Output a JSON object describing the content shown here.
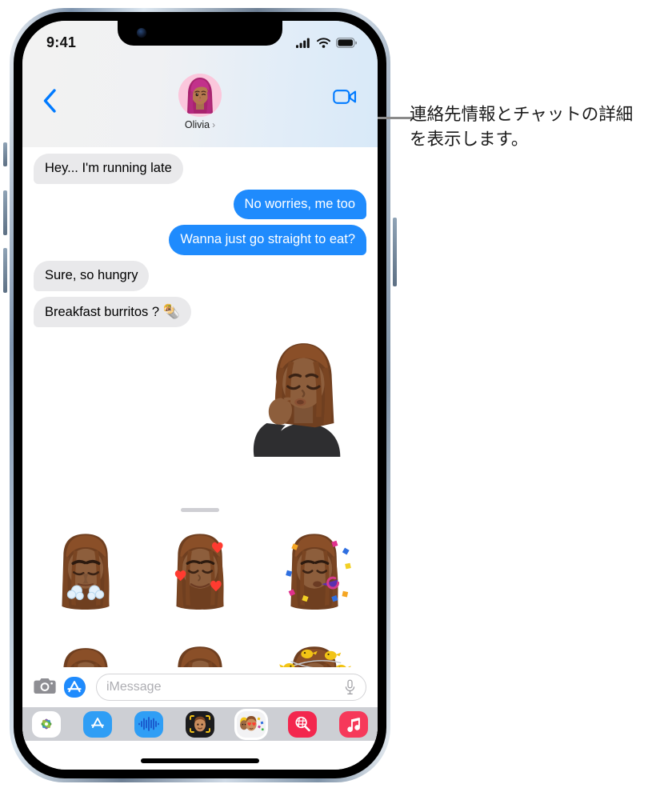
{
  "status_bar": {
    "time": "9:41",
    "cellular_icon": "cellular-bars-icon",
    "wifi_icon": "wifi-icon",
    "battery_icon": "battery-icon"
  },
  "header": {
    "back_icon": "chevron-left-icon",
    "video_icon": "facetime-video-icon",
    "contact_name": "Olivia",
    "contact_chevron": "›",
    "avatar_icon": "memoji-avatar-olivia"
  },
  "conversation": {
    "messages": [
      {
        "id": "msg-1",
        "side": "in",
        "text": "Hey... I'm running late",
        "emoji": ""
      },
      {
        "id": "msg-2",
        "side": "out",
        "text": "No worries, me too",
        "emoji": ""
      },
      {
        "id": "msg-3",
        "side": "out",
        "text": "Wanna just go straight to eat?",
        "emoji": ""
      },
      {
        "id": "msg-4",
        "side": "in",
        "text": "Sure, so hungry",
        "emoji": ""
      },
      {
        "id": "msg-5",
        "side": "in",
        "text": "Breakfast burritos ?",
        "emoji": "🌯"
      }
    ],
    "sent_sticker": "memoji-sticker-chefs-kiss"
  },
  "input_bar": {
    "camera_icon": "camera-icon",
    "appstore_icon": "app-store-icon",
    "placeholder": "iMessage",
    "value": "",
    "mic_icon": "microphone-icon"
  },
  "app_drawer": {
    "apps": [
      {
        "id": "photos",
        "label": "Photos",
        "icon": "photos-icon",
        "color": "#ffffff",
        "selected": false
      },
      {
        "id": "app-store",
        "label": "App Store",
        "icon": "app-store-icon",
        "color": "#1f9af5",
        "selected": false
      },
      {
        "id": "audio-message",
        "label": "Audio",
        "icon": "soundwave-icon",
        "color": "#1f7ae0",
        "selected": false
      },
      {
        "id": "memoji",
        "label": "Memoji",
        "icon": "memoji-icon",
        "color": "#1c1c1e",
        "selected": false
      },
      {
        "id": "memoji-sticker",
        "label": "Memoji Stickers",
        "icon": "memoji-stickers-icon",
        "color": "#f2f2f4",
        "selected": true
      },
      {
        "id": "images-search",
        "label": "#images",
        "icon": "images-search-icon",
        "color": "#f3274e",
        "selected": false
      },
      {
        "id": "apple-music",
        "label": "Music",
        "icon": "music-note-icon",
        "color": "#f6395a",
        "selected": false
      }
    ]
  },
  "sticker_panel": {
    "grabber": "drawer-grabber-handle",
    "stickers": [
      {
        "id": "sticker-steam-nose",
        "name": "memoji-sticker-steam-from-nose"
      },
      {
        "id": "sticker-hearts",
        "name": "memoji-sticker-hearts"
      },
      {
        "id": "sticker-party",
        "name": "memoji-sticker-party-horn"
      },
      {
        "id": "sticker-shy",
        "name": "memoji-sticker-shy-smile"
      },
      {
        "id": "sticker-yawn",
        "name": "memoji-sticker-yawning"
      },
      {
        "id": "sticker-birds",
        "name": "memoji-sticker-birds-around-head"
      }
    ]
  },
  "callout": {
    "text": "連絡先情報とチャットの詳細を表示します。"
  },
  "colors": {
    "imessage_blue": "#1f8bfd",
    "bubble_gray": "#e9e9eb",
    "accent_blue": "#007aff",
    "drawer_gray": "#cdcfd4"
  },
  "home_indicator": "home-indicator"
}
